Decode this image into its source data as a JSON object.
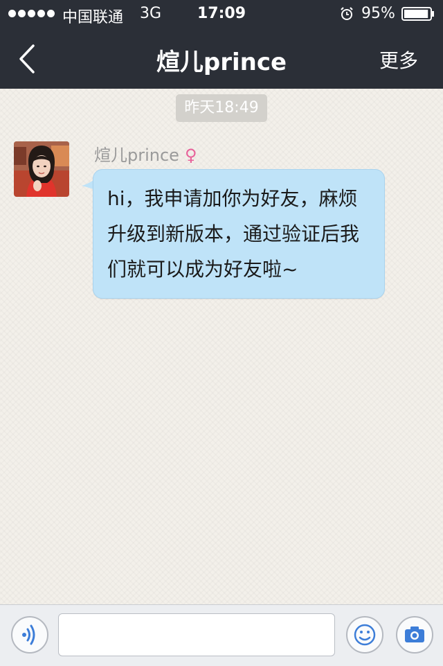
{
  "status_bar": {
    "carrier": "中国联通",
    "network": "3G",
    "time": "17:09",
    "battery": "95%",
    "battery_level": 0.95,
    "signal_bars": 5,
    "alarm_icon": "alarm-clock-icon"
  },
  "nav": {
    "title": "煊儿prince",
    "back_icon": "chevron-left-icon",
    "more_label": "更多"
  },
  "chat": {
    "timestamp": "昨天18:49",
    "messages": [
      {
        "sender": "煊儿prince",
        "gender_symbol": "♀",
        "text": "hi，我申请加你为好友，麻烦升级到新版本，通过验证后我们就可以成为好友啦~"
      }
    ]
  },
  "input_bar": {
    "voice_icon": "voice-icon",
    "input_value": "",
    "emoji_icon": "emoji-icon",
    "camera_icon": "camera-icon"
  },
  "colors": {
    "bar_background": "#2b2f37",
    "chat_background": "#f3f0ea",
    "bubble": "#bfe3f8",
    "gender": "#e8629a"
  }
}
